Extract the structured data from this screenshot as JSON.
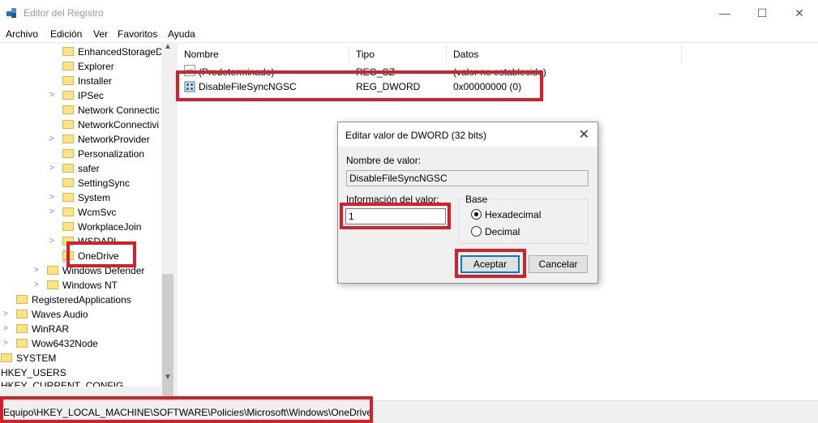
{
  "window": {
    "title": "Editor del Registro"
  },
  "window_controls": {
    "minimize": "—",
    "maximize": "☐",
    "close": "✕"
  },
  "menu": [
    "Archivo",
    "Edición",
    "Ver",
    "Favoritos",
    "Ayuda"
  ],
  "tree": {
    "items": [
      {
        "label": "EnhancedStorageD"
      },
      {
        "label": "Explorer"
      },
      {
        "label": "Installer"
      },
      {
        "label": "IPSec"
      },
      {
        "label": "Network Connectic"
      },
      {
        "label": "NetworkConnectivi"
      },
      {
        "label": "NetworkProvider"
      },
      {
        "label": "Personalization"
      },
      {
        "label": "safer"
      },
      {
        "label": "SettingSync"
      },
      {
        "label": "System"
      },
      {
        "label": "WcmSvc"
      },
      {
        "label": "WorkplaceJoin"
      },
      {
        "label": "WSDAPI"
      },
      {
        "label": "OneDrive"
      },
      {
        "label": "Windows Defender"
      },
      {
        "label": "Windows NT"
      },
      {
        "label": "RegisteredApplications"
      },
      {
        "label": "Waves Audio"
      },
      {
        "label": "WinRAR"
      },
      {
        "label": "Wow6432Node"
      },
      {
        "label": "SYSTEM"
      },
      {
        "label": "HKEY_USERS"
      },
      {
        "label": "HKEY_CURRENT_CONFIG"
      }
    ]
  },
  "list": {
    "columns": [
      "Nombre",
      "Tipo",
      "Datos"
    ],
    "rows": [
      {
        "icon": "ab",
        "name": "(Predeterminado)",
        "type": "REG_SZ",
        "data": "(valor no establecido)"
      },
      {
        "icon": "dword",
        "name": "DisableFileSyncNGSC",
        "type": "REG_DWORD",
        "data": "0x00000000 (0)"
      }
    ]
  },
  "status": {
    "path": "Equipo\\HKEY_LOCAL_MACHINE\\SOFTWARE\\Policies\\Microsoft\\Windows\\OneDrive"
  },
  "dialog": {
    "title": "Editar valor de DWORD (32 bits)",
    "name_label": "Nombre de valor:",
    "name_value": "DisableFileSyncNGSC",
    "data_label": "Información del valor:",
    "data_value": "1",
    "base_label": "Base",
    "base_options": [
      "Hexadecimal",
      "Decimal"
    ],
    "base_selected": "Hexadecimal",
    "ok_label": "Aceptar",
    "cancel_label": "Cancelar"
  },
  "colors": {
    "highlight": "#d4202a",
    "folder": "#fce486",
    "accent": "#0078d7"
  }
}
